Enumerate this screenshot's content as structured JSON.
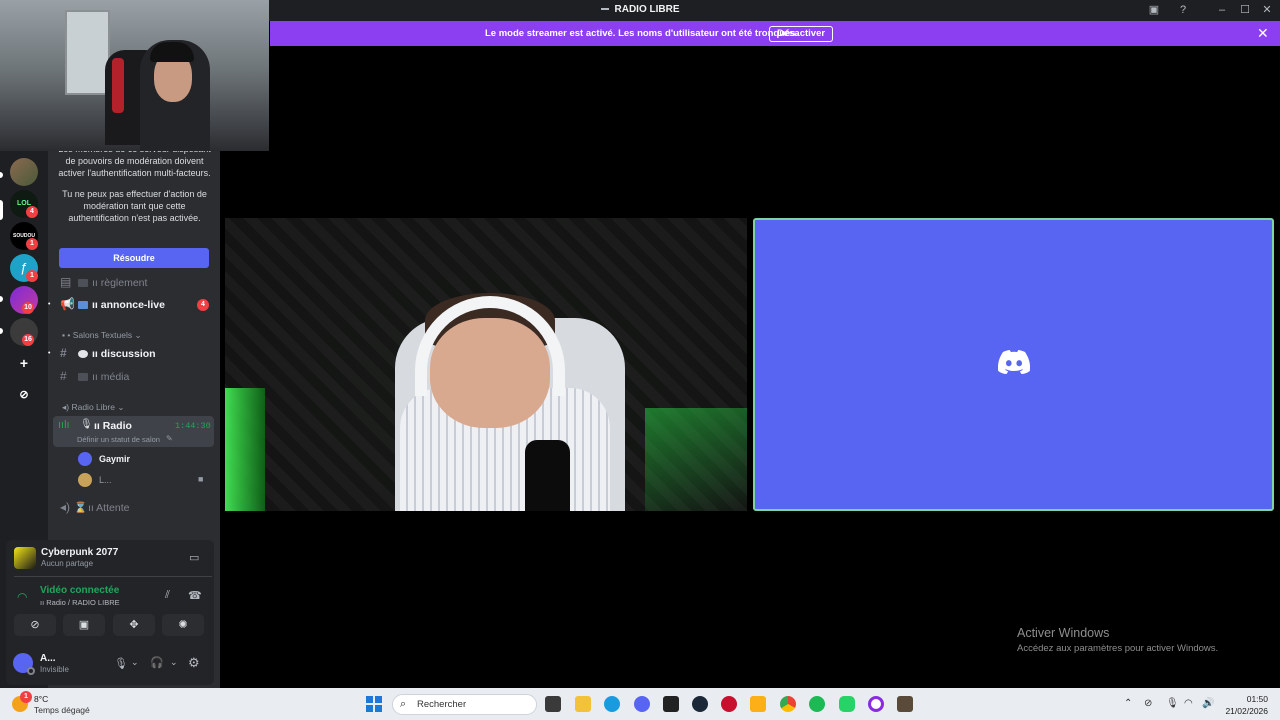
{
  "window": {
    "title": "RADIO LIBRE"
  },
  "banner": {
    "message": "Le mode streamer est activé. Les noms d'utilisateur ont été tronqués.",
    "action_label": "Désactiver",
    "color": "#8b3ff0"
  },
  "servers": [
    {
      "label": "",
      "badge": ""
    },
    {
      "label": "LOL",
      "badge": "4"
    },
    {
      "label": "SOUDOU",
      "badge": "1"
    },
    {
      "label": "",
      "badge": "1"
    },
    {
      "label": "",
      "badge": "10"
    },
    {
      "label": "",
      "badge": "16"
    }
  ],
  "notice": {
    "line1": "Les membres de ce serveur disposant de pouvoirs de modération doivent activer l'authentification multi-facteurs.",
    "line2": "Tu ne peux pas effectuer d'action de modération tant que cette authentification n'est pas activée.",
    "button": "Résoudre"
  },
  "channels": {
    "reglement": "ıı règlement",
    "annonce": "ıı annonce-live",
    "annonce_badge": "4",
    "cat_text": "• Salons Textuels",
    "discussion": "ıı discussion",
    "media": "ıı média",
    "cat_voice": "Radio Libre",
    "radio": "ıı Radio",
    "radio_time": "1:44:30",
    "radio_status": "Définir un statut de salon",
    "user1": "Gaymir",
    "user2": "L...",
    "attente": "ıı Attente"
  },
  "activity": {
    "game": "Cyberpunk 2077",
    "sub": "Aucun partage"
  },
  "voice": {
    "status": "Vidéo connectée",
    "location": "ıı Radio / RADIO LIBRE",
    "status_color": "#23a55a"
  },
  "user": {
    "name": "A...",
    "status": "Invisible"
  },
  "watermark": {
    "title": "Activer Windows",
    "sub": "Accédez aux paramètres pour activer Windows."
  },
  "taskbar": {
    "weather_temp": "8°C",
    "weather_desc": "Temps dégagé",
    "weather_badge": "1",
    "search_placeholder": "Rechercher",
    "time": "01:50",
    "date": "21/02/2026"
  }
}
